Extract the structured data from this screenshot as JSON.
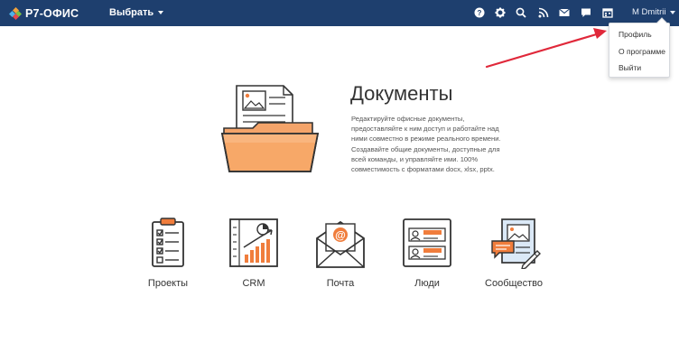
{
  "header": {
    "logo_text": "Р7-ОФИС",
    "choose_label": "Выбрать",
    "user_name": "M Dmitrii",
    "icons": [
      "help-icon",
      "settings-icon",
      "search-icon",
      "feed-icon",
      "mail-icon",
      "chat-icon",
      "calendar-icon"
    ]
  },
  "user_menu": {
    "items": [
      {
        "label": "Профиль"
      },
      {
        "label": "О программе"
      },
      {
        "label": "Выйти"
      }
    ]
  },
  "hero": {
    "title": "Документы",
    "description": "Редактируйте офисные документы, предоставляйте к ним доступ и работайте над ними совместно в режиме реального времени. Создавайте общие документы, доступные для всей команды, и управляйте ими. 100% совместимость с форматами docx, xlsx, pptx."
  },
  "modules": [
    {
      "label": "Проекты"
    },
    {
      "label": "CRM"
    },
    {
      "label": "Почта"
    },
    {
      "label": "Люди"
    },
    {
      "label": "Сообщество"
    }
  ],
  "colors": {
    "topbar": "#1e3f6e",
    "accent_orange": "#f07d3c",
    "annotation_red": "#e0283a"
  }
}
